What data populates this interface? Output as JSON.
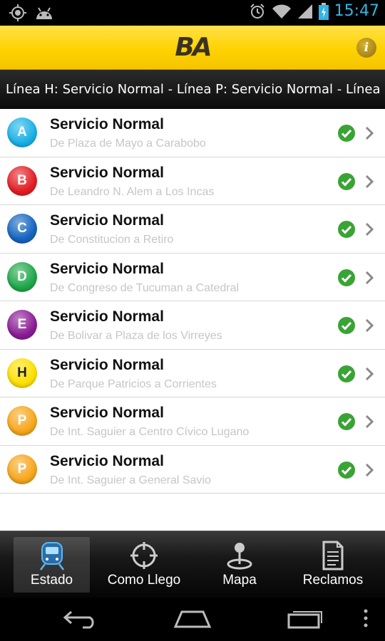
{
  "status_bar": {
    "time": "15:47"
  },
  "header": {
    "logo": "BA",
    "info_label": "i"
  },
  "ticker": {
    "text": "Línea H: Servicio Normal - Línea P: Servicio Normal - Línea U"
  },
  "lines": [
    {
      "letter": "A",
      "color": "#1ab1e6",
      "status": "Servicio Normal",
      "route": "De Plaza de Mayo a Carabobo"
    },
    {
      "letter": "B",
      "color": "#e31e24",
      "status": "Servicio Normal",
      "route": "De Leandro N. Alem a Los Incas"
    },
    {
      "letter": "C",
      "color": "#1565c0",
      "status": "Servicio Normal",
      "route": "De Constitucion a Retiro"
    },
    {
      "letter": "D",
      "color": "#1fa84a",
      "status": "Servicio Normal",
      "route": "De Congreso de Tucuman a Catedral"
    },
    {
      "letter": "E",
      "color": "#8b1d96",
      "status": "Servicio Normal",
      "route": "De Bolivar a Plaza de los Virreyes"
    },
    {
      "letter": "H",
      "color": "#ffe000",
      "status": "Servicio Normal",
      "route": "De Parque Patricios a Corrientes"
    },
    {
      "letter": "P",
      "color": "#f7a71d",
      "status": "Servicio Normal",
      "route": "De Int. Saguier a Centro Cívico Lugano"
    },
    {
      "letter": "P",
      "color": "#f7a71d",
      "status": "Servicio Normal",
      "route": "De Int. Saguier a General Savio"
    }
  ],
  "tabs": [
    {
      "label": "Estado",
      "icon": "train-icon",
      "active": true
    },
    {
      "label": "Como Llego",
      "icon": "crosshair-icon",
      "active": false
    },
    {
      "label": "Mapa",
      "icon": "map-pin-icon",
      "active": false
    },
    {
      "label": "Reclamos",
      "icon": "document-icon",
      "active": false
    }
  ],
  "colors": {
    "accent_yellow": "#ffd200",
    "ok_green": "#3aa335",
    "status_blue": "#33b5e5"
  }
}
